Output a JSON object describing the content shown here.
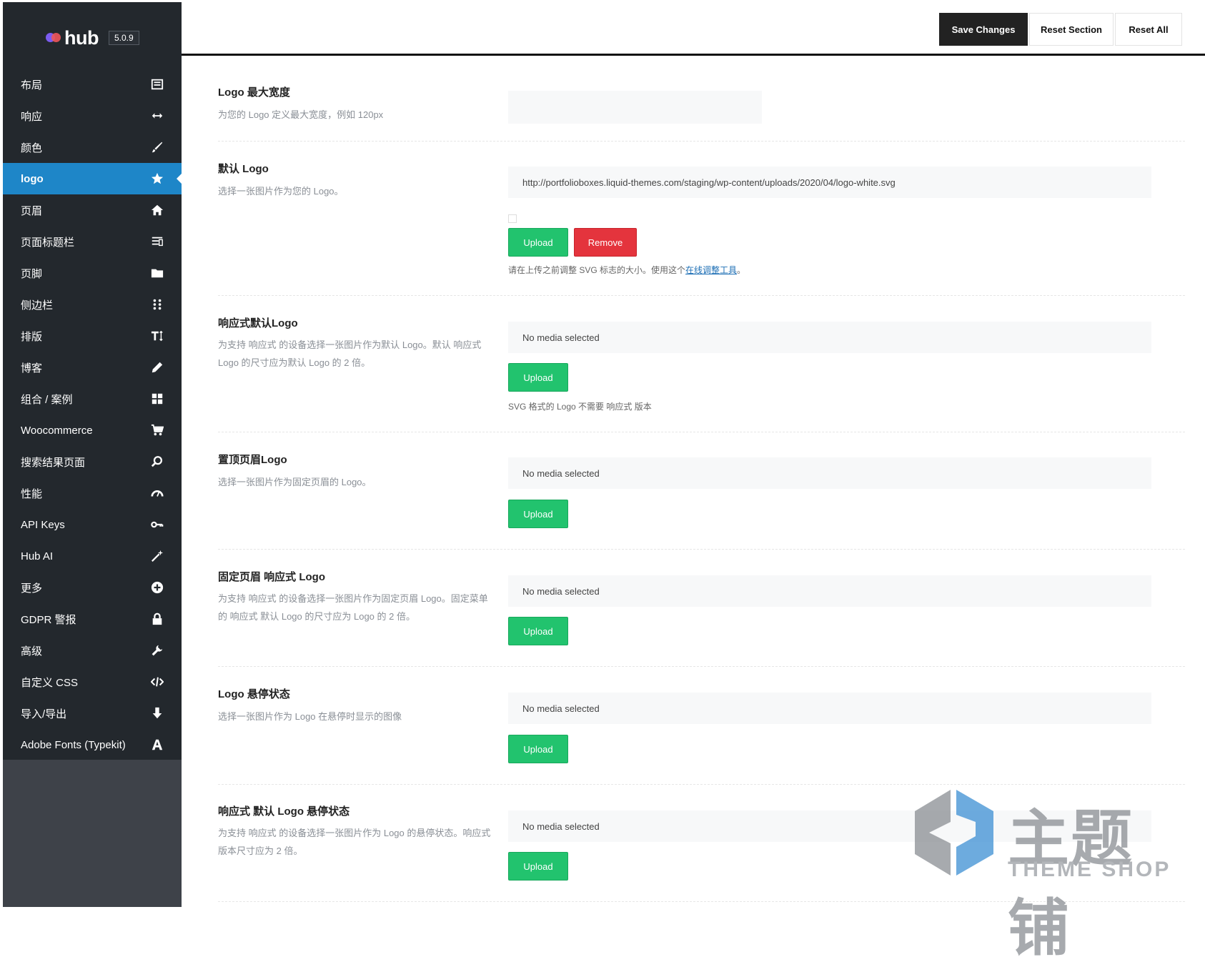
{
  "brand": {
    "name": "hub",
    "version": "5.0.9"
  },
  "toolbar": {
    "save": "Save Changes",
    "reset_section": "Reset Section",
    "reset_all": "Reset All"
  },
  "sidebar": {
    "items": [
      {
        "label": "布局",
        "icon": "layout-icon"
      },
      {
        "label": "响应",
        "icon": "arrows-horizontal-icon"
      },
      {
        "label": "颜色",
        "icon": "brush-icon"
      },
      {
        "label": "logo",
        "icon": "star-icon",
        "active": true
      },
      {
        "label": "页眉",
        "icon": "home-icon"
      },
      {
        "label": "页面标题栏",
        "icon": "list-icon"
      },
      {
        "label": "页脚",
        "icon": "folder-icon"
      },
      {
        "label": "侧边栏",
        "icon": "grid-dots-icon"
      },
      {
        "label": "排版",
        "icon": "text-height-icon"
      },
      {
        "label": "博客",
        "icon": "pencil-icon"
      },
      {
        "label": "组合 / 案例",
        "icon": "grid-icon"
      },
      {
        "label": "Woocommerce",
        "icon": "cart-icon"
      },
      {
        "label": "搜索结果页面",
        "icon": "search-icon"
      },
      {
        "label": "性能",
        "icon": "dashboard-icon"
      },
      {
        "label": "API Keys",
        "icon": "key-icon"
      },
      {
        "label": "Hub AI",
        "icon": "magic-wand-icon"
      },
      {
        "label": "更多",
        "icon": "plus-circle-icon"
      },
      {
        "label": "GDPR 警报",
        "icon": "lock-icon"
      },
      {
        "label": "高级",
        "icon": "wrench-icon"
      },
      {
        "label": "自定义 CSS",
        "icon": "code-icon"
      },
      {
        "label": "导入/导出",
        "icon": "arrow-down-icon"
      },
      {
        "label": "Adobe Fonts (Typekit)",
        "icon": "font-icon"
      }
    ]
  },
  "fields": {
    "max_width": {
      "title": "Logo 最大宽度",
      "desc": "为您的 Logo 定义最大宽度，例如 120px",
      "value": ""
    },
    "default_logo": {
      "title": "默认 Logo",
      "desc": "选择一张图片作为您的 Logo。",
      "value": "http://portfolioboxes.liquid-themes.com/staging/wp-content/uploads/2020/04/logo-white.svg",
      "upload": "Upload",
      "remove": "Remove",
      "help_prefix": "请在上传之前调整 SVG 标志的大小。使用这个",
      "help_link": "在线调整工具",
      "help_suffix": "。"
    },
    "retina_logo": {
      "title": "响应式默认Logo",
      "desc": "为支持 响应式 的设备选择一张图片作为默认 Logo。默认 响应式 Logo 的尺寸应为默认 Logo 的 2 倍。",
      "value": "No media selected",
      "upload": "Upload",
      "help": "SVG 格式的 Logo 不需要 响应式 版本"
    },
    "sticky_logo": {
      "title": "置顶页眉Logo",
      "desc": "选择一张图片作为固定页眉的 Logo。",
      "value": "No media selected",
      "upload": "Upload"
    },
    "sticky_retina_logo": {
      "title": "固定页眉 响应式 Logo",
      "desc": "为支持 响应式 的设备选择一张图片作为固定页眉 Logo。固定菜单的 响应式 默认 Logo 的尺寸应为 Logo 的 2 倍。",
      "value": "No media selected",
      "upload": "Upload"
    },
    "hover_logo": {
      "title": "Logo 悬停状态",
      "desc": "选择一张图片作为 Logo 在悬停时显示的图像",
      "value": "No media selected",
      "upload": "Upload"
    },
    "retina_hover_logo": {
      "title": "响应式 默认 Logo 悬停状态",
      "desc": "为支持 响应式 的设备选择一张图片作为 Logo 的悬停状态。响应式 版本尺寸应为 2 倍。",
      "value": "No media selected",
      "upload": "Upload"
    }
  },
  "watermark": {
    "cn": "主题铺",
    "en": "THEME SHOP"
  }
}
